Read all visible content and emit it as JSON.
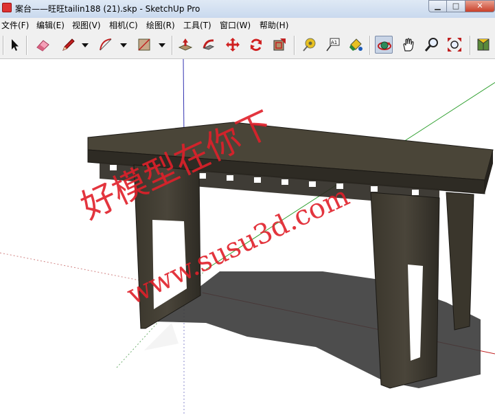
{
  "window": {
    "title": "案台——旺旺tailin188 (21).skp - SketchUp Pro",
    "minimize": "▁",
    "maximize": "□",
    "close": "✕"
  },
  "menu": [
    "文件(F)",
    "编辑(E)",
    "视图(V)",
    "相机(C)",
    "绘图(R)",
    "工具(T)",
    "窗口(W)",
    "帮助(H)"
  ],
  "toolbar": {
    "tools": [
      {
        "name": "select-tool",
        "icon": "arrow-cursor-icon"
      },
      {
        "name": "eraser-tool",
        "icon": "eraser-icon"
      },
      {
        "name": "pencil-tool",
        "icon": "pencil-icon"
      },
      {
        "name": "arc-tool",
        "icon": "arc-icon"
      },
      {
        "name": "rectangle-tool",
        "icon": "rectangle-icon"
      },
      {
        "name": "push-pull-tool",
        "icon": "push-pull-icon"
      },
      {
        "name": "follow-me-tool",
        "icon": "follow-me-icon"
      },
      {
        "name": "move-tool",
        "icon": "move-arrows-icon"
      },
      {
        "name": "rotate-tool",
        "icon": "rotate-icon"
      },
      {
        "name": "offset-tool",
        "icon": "offset-icon"
      },
      {
        "name": "tape-measure-tool",
        "icon": "tape-measure-icon"
      },
      {
        "name": "text-tool",
        "icon": "text-label-icon"
      },
      {
        "name": "paint-bucket-tool",
        "icon": "paint-bucket-icon"
      },
      {
        "name": "orbit-tool",
        "icon": "orbit-icon"
      },
      {
        "name": "pan-tool",
        "icon": "hand-icon"
      },
      {
        "name": "zoom-tool",
        "icon": "magnifier-icon"
      },
      {
        "name": "zoom-extents-tool",
        "icon": "zoom-extents-icon"
      },
      {
        "name": "3d-warehouse-tool",
        "icon": "warehouse-icon"
      }
    ],
    "text_tool_glyph": "A1",
    "active_tool": "orbit-tool"
  },
  "viewport": {
    "watermark_cn": "好模型在你下",
    "watermark_url": "www.susu3d.com"
  }
}
